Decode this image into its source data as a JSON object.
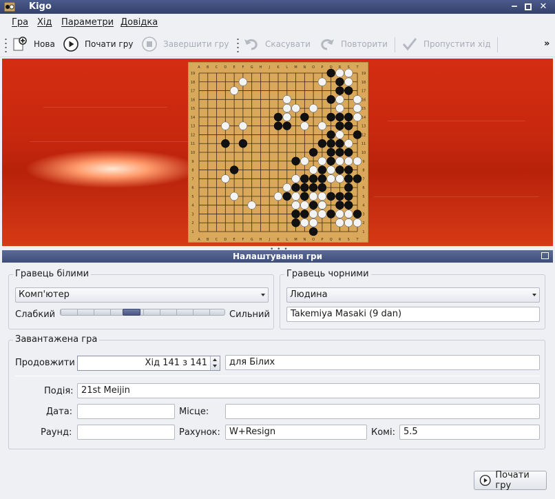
{
  "window": {
    "title": "Kigo"
  },
  "menu": {
    "items": [
      "Гра",
      "Хід",
      "Параметри",
      "Довідка"
    ]
  },
  "toolbar": {
    "new_label": "Нова",
    "start_label": "Почати гру",
    "finish_label": "Завершити гру",
    "undo_label": "Скасувати",
    "redo_label": "Повторити",
    "pass_label": "Пропустити хід",
    "more_label": "»"
  },
  "board": {
    "size": 19,
    "columns": [
      "A",
      "B",
      "C",
      "D",
      "E",
      "F",
      "G",
      "H",
      "J",
      "K",
      "L",
      "M",
      "N",
      "O",
      "P",
      "Q",
      "R",
      "S",
      "T"
    ],
    "black": [
      [
        15,
        18
      ],
      [
        16,
        17
      ],
      [
        16,
        16
      ],
      [
        17,
        16
      ],
      [
        15,
        15
      ],
      [
        9,
        13
      ],
      [
        10,
        13
      ],
      [
        9,
        12
      ],
      [
        10,
        12
      ],
      [
        12,
        13
      ],
      [
        15,
        13
      ],
      [
        16,
        13
      ],
      [
        17,
        13
      ],
      [
        16,
        12
      ],
      [
        17,
        12
      ],
      [
        18,
        11
      ],
      [
        15,
        11
      ],
      [
        14,
        10
      ],
      [
        15,
        10
      ],
      [
        16,
        10
      ],
      [
        15,
        9
      ],
      [
        16,
        9
      ],
      [
        17,
        9
      ],
      [
        3,
        10
      ],
      [
        5,
        10
      ],
      [
        11,
        8
      ],
      [
        13,
        9
      ],
      [
        15,
        8
      ],
      [
        16,
        7
      ],
      [
        17,
        7
      ],
      [
        14,
        7
      ],
      [
        4,
        7
      ],
      [
        12,
        6
      ],
      [
        13,
        6
      ],
      [
        14,
        6
      ],
      [
        17,
        6
      ],
      [
        18,
        6
      ],
      [
        11,
        5
      ],
      [
        12,
        5
      ],
      [
        13,
        5
      ],
      [
        14,
        5
      ],
      [
        17,
        5
      ],
      [
        10,
        4
      ],
      [
        12,
        4
      ],
      [
        15,
        4
      ],
      [
        16,
        4
      ],
      [
        17,
        4
      ],
      [
        13,
        3
      ],
      [
        14,
        3
      ],
      [
        16,
        3
      ],
      [
        17,
        3
      ],
      [
        11,
        2
      ],
      [
        12,
        2
      ],
      [
        15,
        2
      ],
      [
        18,
        2
      ],
      [
        11,
        1
      ],
      [
        13,
        0
      ]
    ],
    "white": [
      [
        16,
        18
      ],
      [
        17,
        18
      ],
      [
        14,
        17
      ],
      [
        17,
        17
      ],
      [
        16,
        15
      ],
      [
        18,
        15
      ],
      [
        5,
        17
      ],
      [
        4,
        16
      ],
      [
        10,
        15
      ],
      [
        10,
        14
      ],
      [
        11,
        14
      ],
      [
        10,
        13
      ],
      [
        13,
        14
      ],
      [
        16,
        14
      ],
      [
        12,
        12
      ],
      [
        14,
        12
      ],
      [
        18,
        14
      ],
      [
        18,
        13
      ],
      [
        3,
        12
      ],
      [
        5,
        12
      ],
      [
        17,
        10
      ],
      [
        16,
        11
      ],
      [
        16,
        8
      ],
      [
        15,
        7
      ],
      [
        14,
        8
      ],
      [
        17,
        8
      ],
      [
        16,
        6
      ],
      [
        18,
        8
      ],
      [
        13,
        7
      ],
      [
        15,
        6
      ],
      [
        13,
        4
      ],
      [
        14,
        4
      ],
      [
        11,
        4
      ],
      [
        9,
        4
      ],
      [
        10,
        5
      ],
      [
        11,
        3
      ],
      [
        12,
        3
      ],
      [
        14,
        2
      ],
      [
        13,
        2
      ],
      [
        12,
        1
      ],
      [
        13,
        1
      ],
      [
        16,
        1
      ],
      [
        16,
        2
      ],
      [
        17,
        2
      ],
      [
        3,
        6
      ],
      [
        4,
        4
      ],
      [
        6,
        3
      ],
      [
        11,
        6
      ],
      [
        12,
        8
      ],
      [
        14,
        3
      ],
      [
        13,
        1
      ],
      [
        17,
        1
      ],
      [
        18,
        1
      ]
    ]
  },
  "dock": {
    "title": "Налаштування гри"
  },
  "white_player": {
    "group_title": "Гравець білими",
    "type": "Комп'ютер",
    "weak_label": "Слабкий",
    "strong_label": "Сильний",
    "strength_fraction": 0.42
  },
  "black_player": {
    "group_title": "Гравець чорними",
    "type": "Людина",
    "name": "Takemiya Masaki (9 dan)"
  },
  "loaded_game": {
    "group_title": "Завантажена гра",
    "continue_label": "Продовжити",
    "move_value": "Хід 141 з 141",
    "for_label": "для Білих",
    "event_label": "Подія:",
    "event": "21st Meijin",
    "date_label": "Дата:",
    "date": "",
    "place_label": "Місце:",
    "place": "",
    "round_label": "Раунд:",
    "round": "",
    "score_label": "Рахунок:",
    "score": "W+Resign",
    "komi_label": "Комі:",
    "komi": "5.5"
  },
  "start_button": {
    "label": "Почати гру"
  }
}
